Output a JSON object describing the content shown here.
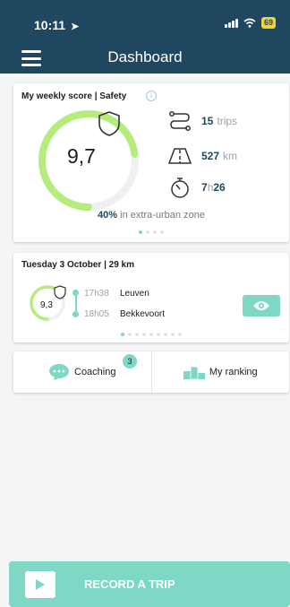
{
  "status_bar": {
    "time": "10:11",
    "battery": "69"
  },
  "header": {
    "title": "Dashboard"
  },
  "weekly": {
    "title": "My weekly score | Safety",
    "score": "9,7",
    "score_fraction": 0.97,
    "trips_value": "15",
    "trips_unit": "trips",
    "km_value": "527",
    "km_unit": "km",
    "time_hours": "7",
    "time_sep": "h",
    "time_minutes": "26",
    "extra_urban_pct": "40%",
    "extra_urban_text": "in extra-urban zone",
    "pager": {
      "count": 4,
      "active": 0
    }
  },
  "trip": {
    "title": "Tuesday 3 October | 29 km",
    "score": "9,3",
    "score_fraction": 0.93,
    "start_time": "17h38",
    "start_place": "Leuven",
    "end_time": "18h05",
    "end_place": "Bekkevoort",
    "pager": {
      "count": 9,
      "active": 0
    }
  },
  "actions": {
    "coaching_label": "Coaching",
    "coaching_badge": "3",
    "ranking_label": "My ranking"
  },
  "record": {
    "label": "RECORD A TRIP"
  },
  "colors": {
    "header": "#1f4760",
    "accent": "#7ed8c5",
    "ring": "#b6ec7c",
    "battery": "#f0d33c"
  }
}
